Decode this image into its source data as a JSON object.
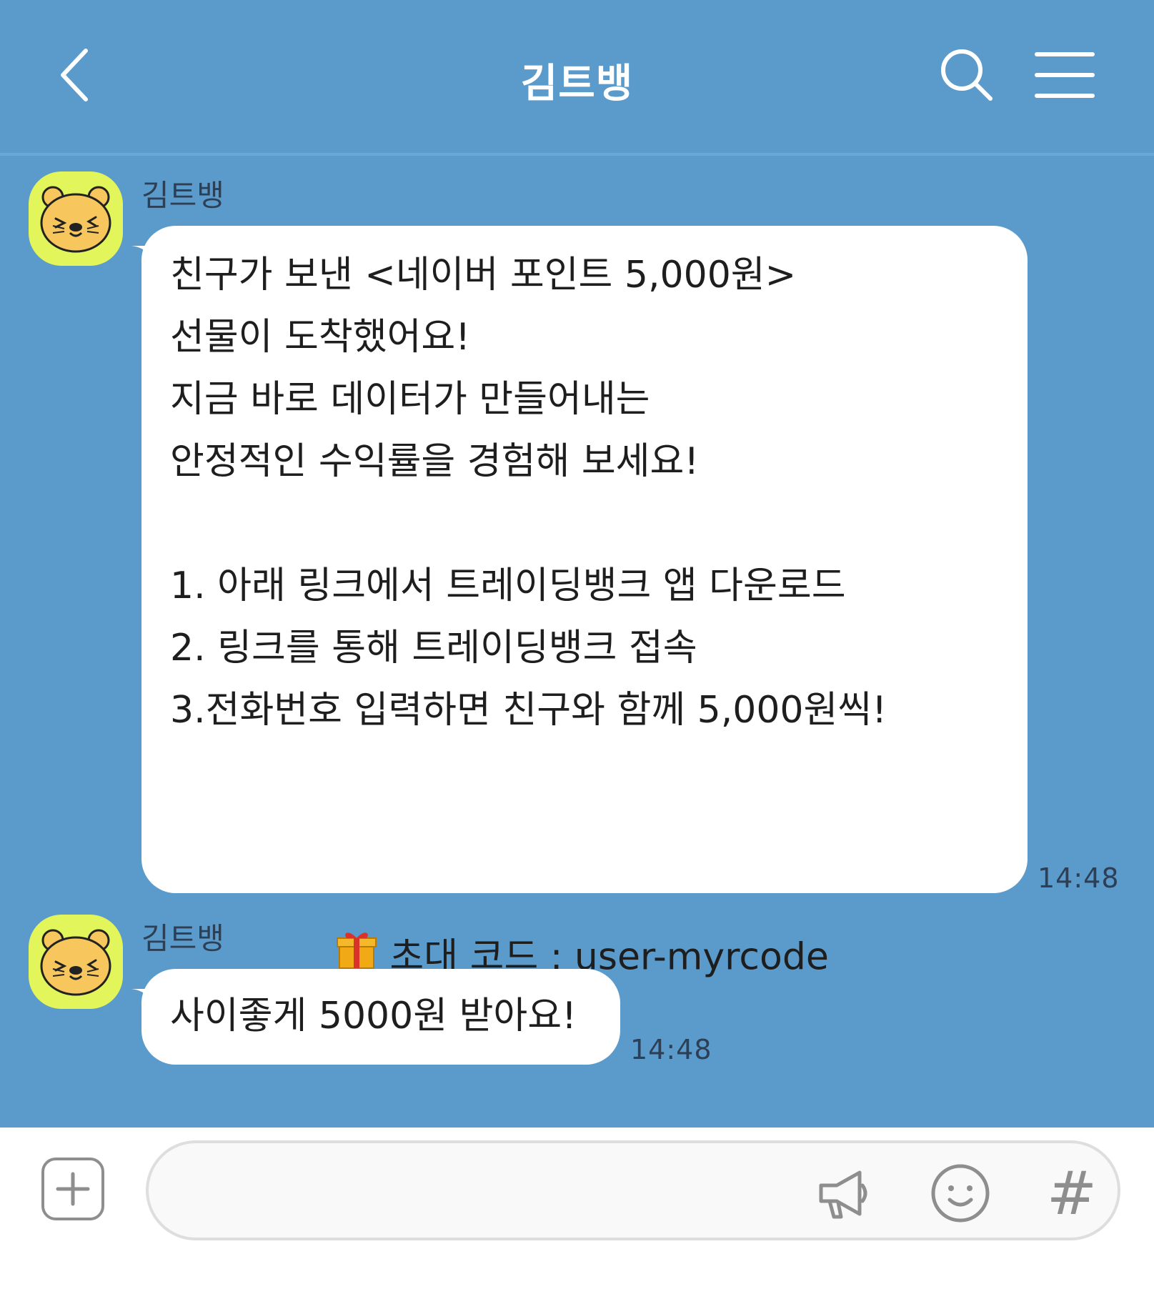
{
  "header": {
    "title": "김트뱅",
    "back_icon": "chevron-left-icon",
    "search_icon": "search-icon",
    "menu_icon": "hamburger-menu-icon"
  },
  "messages": [
    {
      "sender": "김트뱅",
      "lines": [
        "친구가 보낸 <네이버 포인트 5,000원>",
        "선물이 도착했어요!",
        "지금 바로 데이터가 만들어내는",
        "안정적인 수익률을 경험해 보세요!",
        "",
        "1. 아래 링크에서 트레이딩뱅크 앱 다운로드",
        "2. 링크를 통해 트레이딩뱅크 접속",
        "3.전화번호 입력하면 친구와 함께 5,000원씩!",
        ""
      ],
      "invite_code_text": "초대 코드 : user-myrcode",
      "invite_icon": "gift-icon",
      "time": "14:48"
    },
    {
      "sender": "김트뱅",
      "lines": [
        "사이좋게 5000원 받아요!"
      ],
      "time": "14:48"
    }
  ],
  "input_bar": {
    "placeholder": "",
    "plus_icon": "plus-icon",
    "megaphone_icon": "megaphone-icon",
    "emoji_icon": "emoji-icon",
    "hash_label": "#"
  },
  "colors": {
    "background": "#5b9bcc",
    "bubble": "#ffffff",
    "avatar_bg": "#e2f55a"
  }
}
